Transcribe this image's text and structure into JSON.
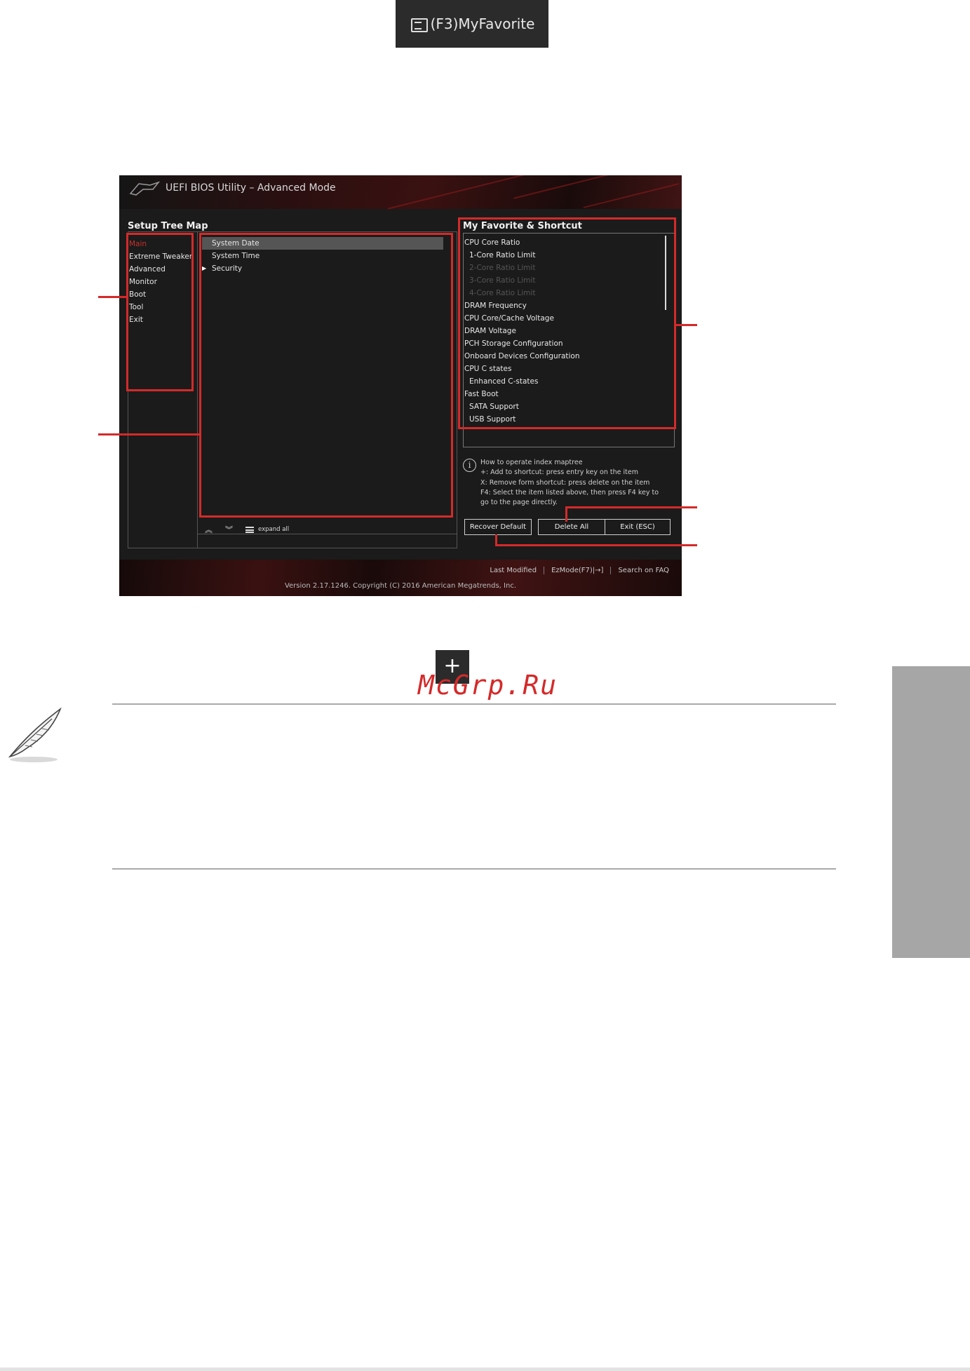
{
  "f3_button": {
    "label": "(F3)MyFavorite",
    "icon": "list-window-icon"
  },
  "bios": {
    "title": "UEFI BIOS Utility – Advanced Mode",
    "setup_tree_title": "Setup Tree Map",
    "menu": [
      {
        "label": "Main",
        "active": true
      },
      {
        "label": "Extreme Tweaker"
      },
      {
        "label": "Advanced"
      },
      {
        "label": "Monitor"
      },
      {
        "label": "Boot"
      },
      {
        "label": "Tool"
      },
      {
        "label": "Exit"
      }
    ],
    "sub_items": [
      {
        "label": "System Date",
        "selected": true
      },
      {
        "label": "System Time"
      },
      {
        "label": "Security",
        "arrow": "▶"
      }
    ],
    "mid_tools": {
      "collapse_icon": "double-chevron-up-icon",
      "expand_icon": "double-chevron-down-icon",
      "expand_all": "expand all"
    },
    "favorites_title": "My Favorite & Shortcut",
    "favorites": [
      {
        "label": "CPU Core Ratio"
      },
      {
        "label": "1-Core Ratio Limit",
        "indent": true
      },
      {
        "label": "2-Core Ratio Limit",
        "indent": true,
        "dim": true
      },
      {
        "label": "3-Core Ratio Limit",
        "indent": true,
        "dim": true
      },
      {
        "label": "4-Core Ratio Limit",
        "indent": true,
        "dim": true
      },
      {
        "label": "DRAM Frequency"
      },
      {
        "label": "CPU Core/Cache Voltage"
      },
      {
        "label": "DRAM Voltage"
      },
      {
        "label": "PCH Storage Configuration"
      },
      {
        "label": "Onboard Devices Configuration"
      },
      {
        "label": "CPU C states"
      },
      {
        "label": "Enhanced C-states",
        "indent": true
      },
      {
        "label": "Fast Boot"
      },
      {
        "label": "SATA Support",
        "indent": true
      },
      {
        "label": "USB Support",
        "indent": true
      }
    ],
    "help": {
      "line1": "How to operate index maptree",
      "line2": "+: Add to shortcut: press entry key on the item",
      "line3": "X: Remove form shortcut: press delete on the item",
      "line4": "F4: Select the item listed above, then press F4 key to",
      "line5": "go to the page directly."
    },
    "buttons": {
      "recover_default": "Recover Default",
      "delete_all": "Delete All",
      "exit": "Exit (ESC)"
    },
    "footer": {
      "last_modified": "Last Modified",
      "ezmode": "EzMode(F7)|→]",
      "search": "Search on FAQ",
      "version": "Version 2.17.1246. Copyright (C) 2016 American Megatrends, Inc."
    }
  },
  "plus_button": {
    "label": "+"
  },
  "watermark": "McGrp.Ru",
  "colors": {
    "annotation_red": "#d42a2a",
    "active_menu_red": "#c8312c",
    "side_tab_gray": "#a6a6a6"
  }
}
